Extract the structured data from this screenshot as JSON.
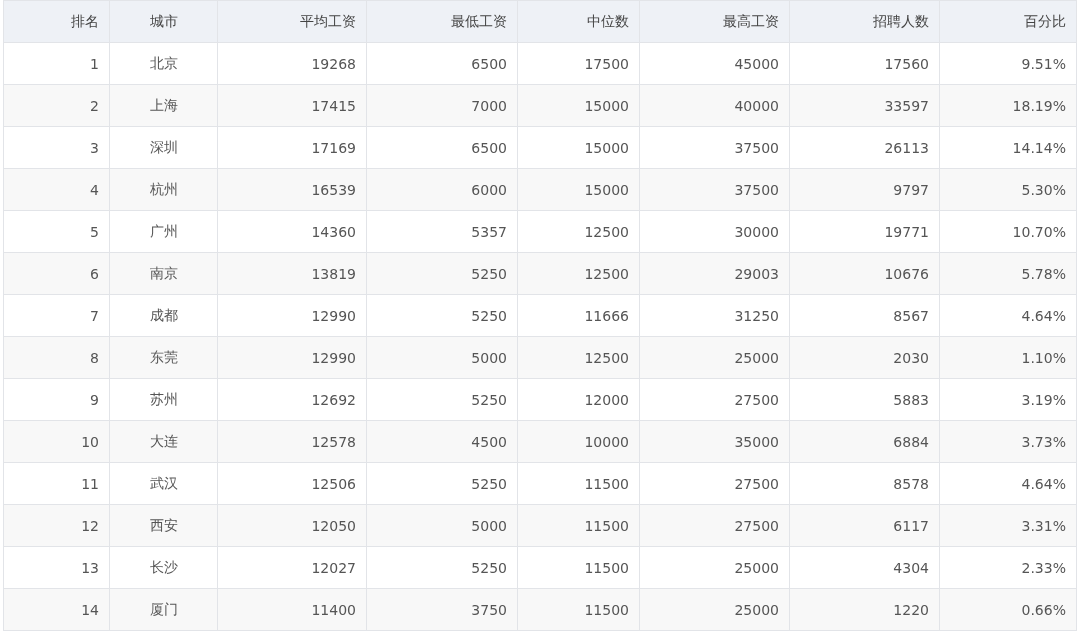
{
  "table": {
    "columns": [
      "排名",
      "城市",
      "平均工资",
      "最低工资",
      "中位数",
      "最高工资",
      "招聘人数",
      "百分比"
    ],
    "rows": [
      [
        "1",
        "北京",
        "19268",
        "6500",
        "17500",
        "45000",
        "17560",
        "9.51%"
      ],
      [
        "2",
        "上海",
        "17415",
        "7000",
        "15000",
        "40000",
        "33597",
        "18.19%"
      ],
      [
        "3",
        "深圳",
        "17169",
        "6500",
        "15000",
        "37500",
        "26113",
        "14.14%"
      ],
      [
        "4",
        "杭州",
        "16539",
        "6000",
        "15000",
        "37500",
        "9797",
        "5.30%"
      ],
      [
        "5",
        "广州",
        "14360",
        "5357",
        "12500",
        "30000",
        "19771",
        "10.70%"
      ],
      [
        "6",
        "南京",
        "13819",
        "5250",
        "12500",
        "29003",
        "10676",
        "5.78%"
      ],
      [
        "7",
        "成都",
        "12990",
        "5250",
        "11666",
        "31250",
        "8567",
        "4.64%"
      ],
      [
        "8",
        "东莞",
        "12990",
        "5000",
        "12500",
        "25000",
        "2030",
        "1.10%"
      ],
      [
        "9",
        "苏州",
        "12692",
        "5250",
        "12000",
        "27500",
        "5883",
        "3.19%"
      ],
      [
        "10",
        "大连",
        "12578",
        "4500",
        "10000",
        "35000",
        "6884",
        "3.73%"
      ],
      [
        "11",
        "武汉",
        "12506",
        "5250",
        "11500",
        "27500",
        "8578",
        "4.64%"
      ],
      [
        "12",
        "西安",
        "12050",
        "5000",
        "11500",
        "27500",
        "6117",
        "3.31%"
      ],
      [
        "13",
        "长沙",
        "12027",
        "5250",
        "11500",
        "25000",
        "4304",
        "2.33%"
      ],
      [
        "14",
        "厦门",
        "11400",
        "3750",
        "11500",
        "25000",
        "1220",
        "0.66%"
      ]
    ]
  }
}
